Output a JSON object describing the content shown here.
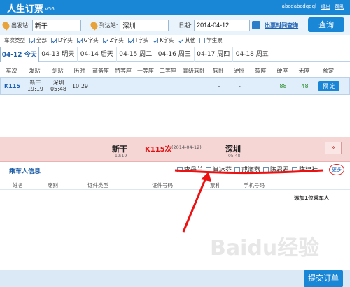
{
  "app": {
    "title": "人生订票",
    "version": "V56",
    "user": "abcdabcdqqql",
    "logout": "退出",
    "help": "帮助"
  },
  "search": {
    "from_label": "出发站:",
    "from_value": "新干",
    "to_label": "到达站:",
    "to_value": "深圳",
    "date_label": "日期:",
    "date_value": "2014-04-12",
    "link": "出票时间查询",
    "query_button": "查询"
  },
  "filters": {
    "label": "车次类型",
    "items": [
      "全部",
      "D字头",
      "G字头",
      "Z字头",
      "T字头",
      "K字头",
      "其他",
      "学生票"
    ]
  },
  "date_tabs": [
    "04-12  今天",
    "04-13  明天",
    "04-14  后天",
    "04-15  周二",
    "04-16  周三",
    "04-17  周四",
    "04-18  周五"
  ],
  "table": {
    "headers": [
      "车次",
      "发站",
      "到站",
      "历时",
      "商务座",
      "特等座",
      "一等座",
      "二等座",
      "高级软卧",
      "软卧",
      "硬卧",
      "软座",
      "硬座",
      "无座",
      "预定"
    ],
    "row": {
      "train": "K115",
      "from": "新干",
      "from_time": "19:19",
      "to": "深圳",
      "to_time": "05:48",
      "duration": "10:29",
      "soft_sleeper": "-",
      "hard_sleeper": "-",
      "hard_seat": "88",
      "no_seat": "48",
      "book": "预 定"
    }
  },
  "order": {
    "from": "新干",
    "from_time": "19:19",
    "train": "K115次",
    "date": "(2014-04-12)",
    "to": "深圳",
    "to_time": "05:48",
    "expand": "»"
  },
  "passenger": {
    "title": "乘车人信息",
    "list": [
      "李丹兰",
      "肖冰芬",
      "戒海燕",
      "陈君君",
      "陈建社"
    ],
    "more": "更多",
    "columns": [
      "姓名",
      "席别",
      "证件类型",
      "证件号码",
      "票种",
      "手机号码"
    ],
    "add": "添加1位乘车人"
  },
  "submit": "提交订单",
  "watermark": "Baidu经验"
}
